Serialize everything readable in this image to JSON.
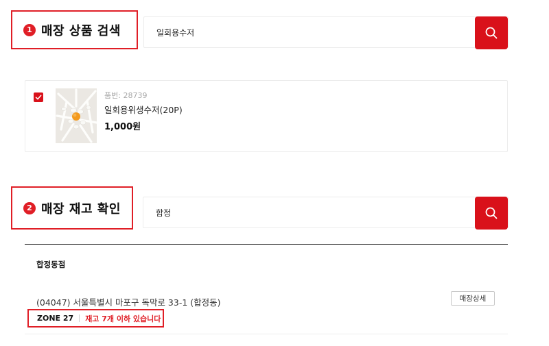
{
  "colors": {
    "accent": "#d9111a",
    "highlight_border": "#e01e26"
  },
  "product_search": {
    "step_number": "1",
    "title": "매장 상품 검색",
    "query": "일회용수저",
    "search_icon": "search-icon"
  },
  "product": {
    "checked": true,
    "code_label": "품번:",
    "code": "28739",
    "name": "일회용위생수저(20P)",
    "price": "1,000원"
  },
  "stock_check": {
    "step_number": "2",
    "title": "매장 재고 확인",
    "query": "합정",
    "search_icon": "search-icon"
  },
  "store": {
    "name": "합정동점",
    "address": "(04047) 서울특별시 마포구 독막로 33-1 (합정동)",
    "detail_button": "매장상세",
    "zone": "ZONE 27",
    "stock_status": "재고 7개 이하 있습니다"
  }
}
